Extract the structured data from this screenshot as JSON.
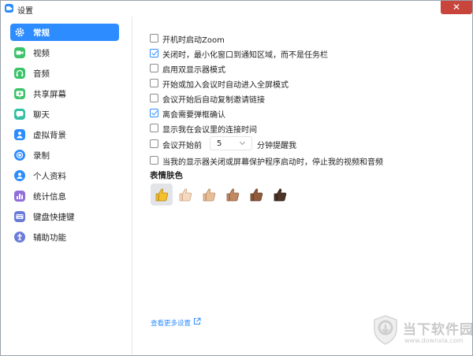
{
  "window": {
    "title": "设置",
    "close_glyph": "✕"
  },
  "sidebar": {
    "items": [
      {
        "label": "常规",
        "icon": "gear-icon",
        "color": "#2d8cff",
        "active": true
      },
      {
        "label": "视频",
        "icon": "video-icon",
        "color": "#3cc36a",
        "active": false
      },
      {
        "label": "音频",
        "icon": "headphones-icon",
        "color": "#3cc36a",
        "active": false
      },
      {
        "label": "共享屏幕",
        "icon": "share-screen-icon",
        "color": "#3cc36a",
        "active": false
      },
      {
        "label": "聊天",
        "icon": "chat-icon",
        "color": "#2fbfa5",
        "active": false
      },
      {
        "label": "虚拟背景",
        "icon": "virtual-background-icon",
        "color": "#2d8cff",
        "active": false
      },
      {
        "label": "录制",
        "icon": "record-icon",
        "color": "#2d8cff",
        "active": false
      },
      {
        "label": "个人资料",
        "icon": "profile-icon",
        "color": "#2d8cff",
        "active": false
      },
      {
        "label": "统计信息",
        "icon": "statistics-icon",
        "color": "#8f6fd8",
        "active": false
      },
      {
        "label": "键盘快捷键",
        "icon": "keyboard-icon",
        "color": "#6b7bd8",
        "active": false
      },
      {
        "label": "辅助功能",
        "icon": "accessibility-icon",
        "color": "#6b7bd8",
        "active": false
      }
    ]
  },
  "general": {
    "options": [
      {
        "label": "开机时启动Zoom",
        "checked": false
      },
      {
        "label": "关闭时，最小化窗口到通知区域，而不是任务栏",
        "checked": true
      },
      {
        "label": "启用双显示器模式",
        "checked": false
      },
      {
        "label": "开始或加入会议时自动进入全屏模式",
        "checked": false
      },
      {
        "label": "会议开始后自动复制邀请链接",
        "checked": false
      },
      {
        "label": "离会需要弹框确认",
        "checked": true
      },
      {
        "label": "显示我在会议里的连接时间",
        "checked": false
      }
    ],
    "reminder": {
      "before_label": "会议开始前",
      "minutes_value": "5",
      "after_label": "分钟提醒我",
      "checked": false
    },
    "screensaver": {
      "label": "当我的显示器关闭或屏幕保护程序启动时，停止我的视频和音频",
      "checked": false
    },
    "skin_tone": {
      "title": "表情肤色",
      "tones": [
        {
          "name": "thumbs-up-default",
          "color": "#f5c02d",
          "selected": true
        },
        {
          "name": "thumbs-up-light",
          "color": "#f7d9bf",
          "selected": false
        },
        {
          "name": "thumbs-up-medium-light",
          "color": "#e8be98",
          "selected": false
        },
        {
          "name": "thumbs-up-medium",
          "color": "#c28a63",
          "selected": false
        },
        {
          "name": "thumbs-up-medium-dark",
          "color": "#8f5b3c",
          "selected": false
        },
        {
          "name": "thumbs-up-dark",
          "color": "#4e3426",
          "selected": false
        }
      ]
    },
    "more_link": "查看更多设置"
  },
  "watermark": {
    "name": "当下软件园",
    "url": "www.downxia.com"
  },
  "colors": {
    "accent": "#2d8cff",
    "close": "#c7453b"
  }
}
